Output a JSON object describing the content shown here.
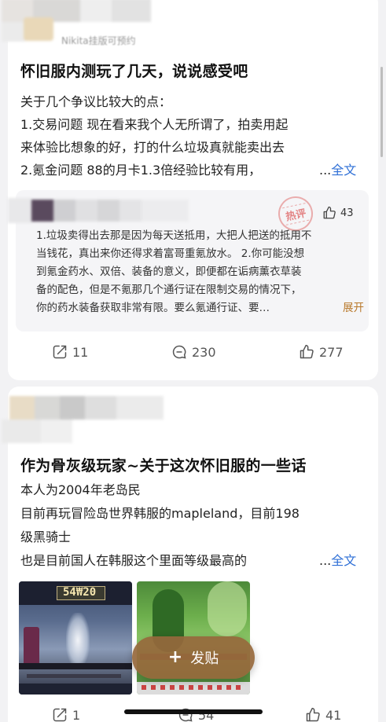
{
  "post1": {
    "author_name": "Nikita挂版可预约",
    "title": "怀旧服内测玩了几天，说说感受吧",
    "body_lines": [
      "关于几个争议比较大的点：",
      "1.交易问题 现在看来我个人无所谓了，拍卖用起",
      "来体验比想象的好，打的什么垃圾真就能卖出去",
      "2.氪金问题 88的月卡1.3倍经验比较有用，"
    ],
    "ellipsis": "...",
    "more_label": "全文",
    "hot_comment": {
      "stamp_label": "热评",
      "like_count": "43",
      "lines": [
        "1.垃圾卖得出去那是因为每天送抵用，大把人把送的抵用不",
        "当钱花，真出来你还得求着富哥重氪放水。 2.你可能没想",
        "到氪金药水、双倍、装备的意义，即便都在诟病薰衣草装",
        "备的配色，但是不氪那几个通行证在限制交易的情况下，",
        "你的药水装备获取非常有限。要么氪通行证、要…"
      ],
      "expand_label": "展开"
    },
    "stats": {
      "shares": "11",
      "comments": "230",
      "likes": "277"
    }
  },
  "post2": {
    "title": "作为骨灰级玩家~关于这次怀旧服的一些话",
    "body_lines": [
      "本人为2004年老岛民",
      "目前再玩冒险岛世界韩服的mapleland，目前198",
      "级黑骑士",
      "也是目前国人在韩服这个里面等级最高的"
    ],
    "ellipsis": "...",
    "more_label": "全文",
    "image1_hud_text": "54₩20",
    "stats": {
      "shares": "1",
      "comments": "54",
      "likes": "41"
    }
  },
  "fab": {
    "plus": "+",
    "label": "发贴"
  },
  "colors": {
    "link": "#2e6fd6",
    "expand": "#b8782a",
    "fab_bg": "#96683c"
  },
  "icons": [
    "share-icon",
    "comment-icon",
    "like-icon"
  ]
}
